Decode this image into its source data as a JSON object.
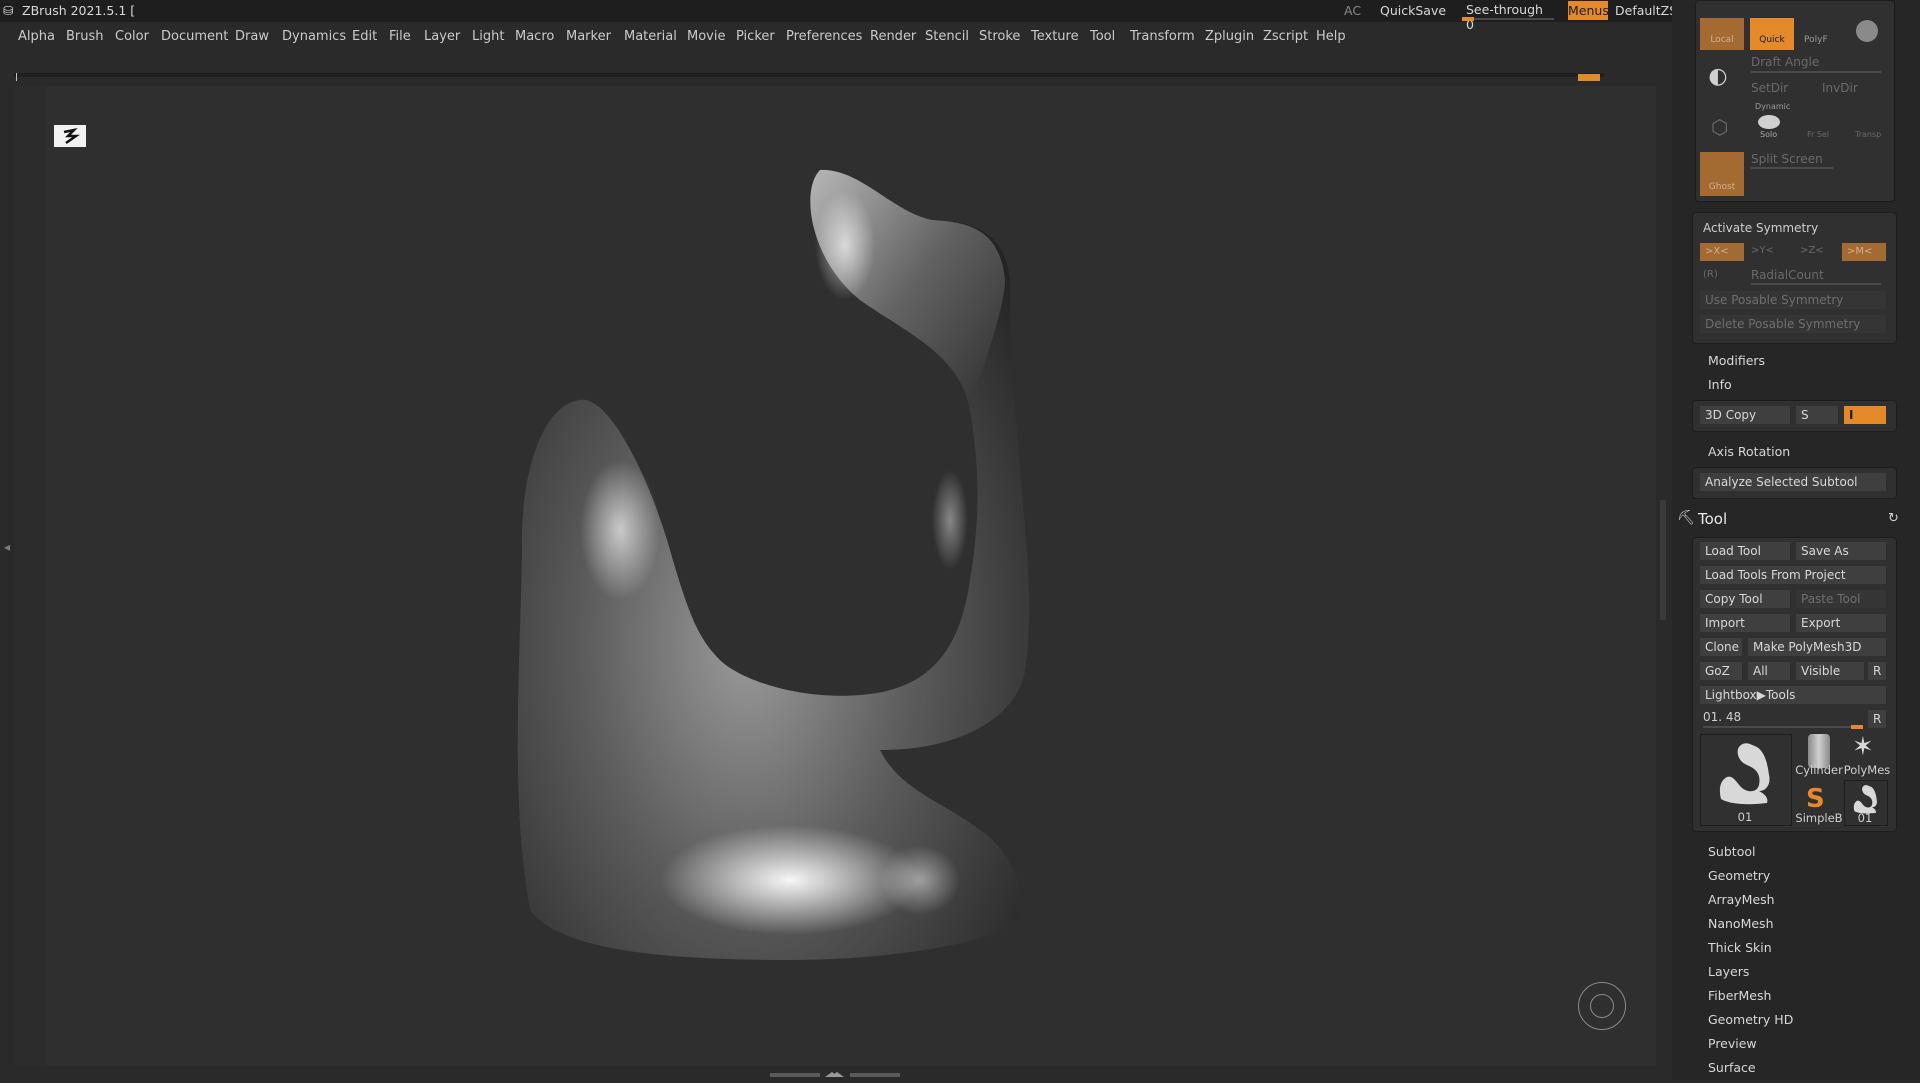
{
  "titlebar": {
    "title": "ZBrush 2021.5.1 [",
    "ac": "AC",
    "quicksave": "QuickSave",
    "seethrough": "See-through  0",
    "seethrough_value": 0,
    "menus": "Menus",
    "zscript": "DefaultZScript"
  },
  "menubar": {
    "items": [
      "Alpha",
      "Brush",
      "Color",
      "Document",
      "Draw",
      "Dynamics",
      "Edit",
      "File",
      "Layer",
      "Light",
      "Macro",
      "Marker",
      "Material",
      "Movie",
      "Picker",
      "Preferences",
      "Render",
      "Stencil",
      "Stroke",
      "Texture",
      "Tool",
      "Transform",
      "Zplugin",
      "Zscript",
      "Help"
    ]
  },
  "top_panel": {
    "local": "Local",
    "quick": "Quick",
    "polyf": "PolyF",
    "draft_angle": "Draft Angle",
    "setdir": "SetDir",
    "invdir": "InvDir",
    "dynamic": "Dynamic",
    "solo": "Solo",
    "fr_sel": "Fr Sel",
    "transp": "Transp",
    "ghost": "Ghost",
    "split_screen": "Split Screen"
  },
  "symmetry": {
    "activate": "Activate Symmetry",
    "x": ">X<",
    "y": ">Y<",
    "z": ">Z<",
    "m": ">M<",
    "r": "(R)",
    "radial_count": "RadialCount",
    "use_posable": "Use Posable Symmetry",
    "delete_posable": "Delete Posable Symmetry"
  },
  "misc": {
    "modifiers": "Modifiers",
    "info": "Info",
    "copy3d": "3D Copy",
    "s": "S",
    "i": "I",
    "axis_rotation": "Axis Rotation",
    "analyze": "Analyze Selected Subtool"
  },
  "tool": {
    "header": "Tool",
    "load_tool": "Load Tool",
    "save_as": "Save As",
    "load_from_project": "Load Tools From Project",
    "copy_tool": "Copy Tool",
    "paste_tool": "Paste Tool",
    "import": "Import",
    "export": "Export",
    "clone": "Clone",
    "make_polymesh": "Make PolyMesh3D",
    "goz": "GoZ",
    "all": "All",
    "visible": "Visible",
    "r": "R",
    "lightbox": "Lightbox▶Tools",
    "slider_label": "01. 48",
    "slider_value": 48,
    "thumbs": {
      "main": "01",
      "cylinder": "Cylinder",
      "polymesh": "PolyMes",
      "simpleb": "SimpleB",
      "small": "01"
    }
  },
  "sections": [
    "Subtool",
    "Geometry",
    "ArrayMesh",
    "NanoMesh",
    "Thick Skin",
    "Layers",
    "FiberMesh",
    "Geometry HD",
    "Preview",
    "Surface"
  ],
  "colors": {
    "accent": "#e58a2a",
    "background": "#2a2a2a",
    "canvas": "#2f2f2f"
  }
}
